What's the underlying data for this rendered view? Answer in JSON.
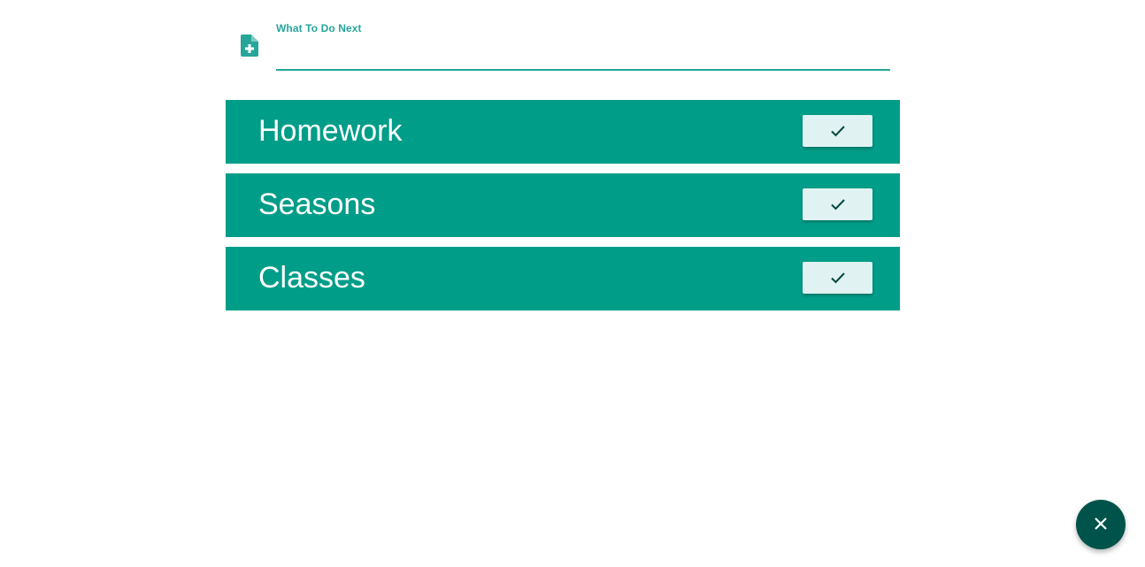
{
  "form": {
    "label": "What To Do Next",
    "value": "",
    "icon": "note-add-icon"
  },
  "todos": [
    {
      "label": "Homework",
      "action_icon": "check-icon"
    },
    {
      "label": "Seasons",
      "action_icon": "check-icon"
    },
    {
      "label": "Classes",
      "action_icon": "check-icon"
    }
  ],
  "fab": {
    "icon": "close-icon"
  },
  "colors": {
    "accent": "#26a69a",
    "item_bg": "#009d88",
    "button_bg": "#e0f2f1",
    "fab_bg": "#00534a"
  }
}
